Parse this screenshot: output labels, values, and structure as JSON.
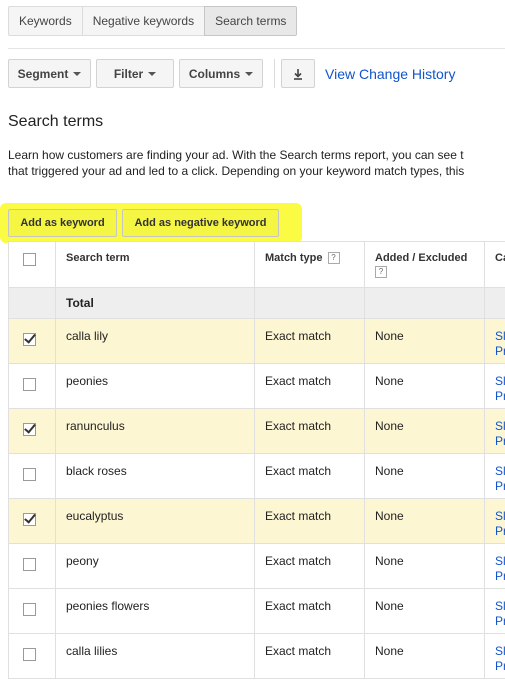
{
  "tabs": [
    "Keywords",
    "Negative keywords",
    "Search terms"
  ],
  "toolbar": {
    "segment": "Segment",
    "filter": "Filter",
    "columns": "Columns",
    "download_icon": "download-icon",
    "view_change_history": "View Change History"
  },
  "page": {
    "title": "Search terms",
    "description_line1": "Learn how customers are finding your ad. With the Search terms report, you can see t",
    "description_line2": "that triggered your ad and led to a click. Depending on your keyword match types, this"
  },
  "actions": {
    "add_keyword": "Add as keyword",
    "add_negative": "Add as negative keyword"
  },
  "table": {
    "headers": {
      "search_term": "Search term",
      "match_type": "Match type",
      "added_excluded": "Added / Excluded",
      "cut": "Ca"
    },
    "help_icon": "?",
    "total_label": "Total",
    "rows": [
      {
        "term": "calla lily",
        "match": "Exact match",
        "status": "None",
        "checked": true,
        "cut1": "Sl",
        "cut2": "Pr"
      },
      {
        "term": "peonies",
        "match": "Exact match",
        "status": "None",
        "checked": false,
        "cut1": "Sl",
        "cut2": "Pr"
      },
      {
        "term": "ranunculus",
        "match": "Exact match",
        "status": "None",
        "checked": true,
        "cut1": "Sl",
        "cut2": "Pr"
      },
      {
        "term": "black roses",
        "match": "Exact match",
        "status": "None",
        "checked": false,
        "cut1": "Sl",
        "cut2": "Pr"
      },
      {
        "term": "eucalyptus",
        "match": "Exact match",
        "status": "None",
        "checked": true,
        "cut1": "Sl",
        "cut2": "Pr"
      },
      {
        "term": "peony",
        "match": "Exact match",
        "status": "None",
        "checked": false,
        "cut1": "Sl",
        "cut2": "Pr"
      },
      {
        "term": "peonies flowers",
        "match": "Exact match",
        "status": "None",
        "checked": false,
        "cut1": "Sl",
        "cut2": "Pr"
      },
      {
        "term": "calla lilies",
        "match": "Exact match",
        "status": "None",
        "checked": false,
        "cut1": "Sl",
        "cut2": "Pr"
      }
    ]
  },
  "colors": {
    "highlight": "#fbfb3a",
    "selected_row": "#fdf6d3",
    "link": "#1155cc"
  }
}
